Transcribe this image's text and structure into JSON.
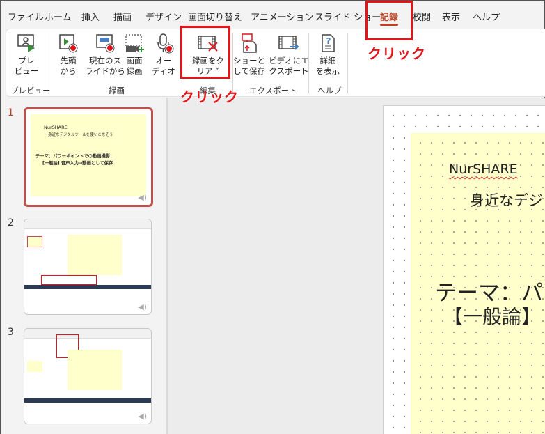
{
  "menu": {
    "tabs": [
      {
        "label": "ファイル"
      },
      {
        "label": "ホーム"
      },
      {
        "label": "挿入"
      },
      {
        "label": "描画"
      },
      {
        "label": "デザイン"
      },
      {
        "label": "画面切り替え"
      },
      {
        "label": "アニメーション"
      },
      {
        "label": "スライド ショー"
      },
      {
        "label": "記録"
      },
      {
        "label": "校閲"
      },
      {
        "label": "表示"
      },
      {
        "label": "ヘルプ"
      }
    ],
    "active_tab": "記録"
  },
  "ribbon": {
    "buttons": {
      "preview": "プレ\nビュー",
      "from_start": "先頭\nから",
      "from_current": "現在のス\nライドから",
      "screen": "画面\n録画",
      "audio": "オー\nディオ",
      "clear": "録画をク\nリア ˅",
      "save_as_show": "ショーと\nして保存",
      "export_video": "ビデオにエ\nクスポート",
      "details": "詳細\nを表示"
    },
    "groups": {
      "preview": "プレビュー",
      "record": "録画",
      "edit": "編集",
      "export": "エクスポート",
      "help": "ヘルプ"
    }
  },
  "annotations": {
    "click_record_tab": "クリック",
    "click_clear": "クリック"
  },
  "slides": [
    {
      "number": "1",
      "title": "NurSHARE",
      "subtitle": "身近なデジタルツールを使いこなそう",
      "theme_line1": "テーマ：パワーポイントでの動画撮影：",
      "theme_line2": "[一般論] 音声入力→動画として保存"
    },
    {
      "number": "2"
    },
    {
      "number": "3"
    }
  ],
  "slide_view": {
    "title": "NurSHARE",
    "subtitle_partial": "身近なデジ",
    "theme_partial_1": "テーマ：パ",
    "theme_partial_2": "【一般論】"
  },
  "colors": {
    "accent": "#c43e1c",
    "annotation_red": "#e2151b",
    "slide_yellow": "#ffffcc"
  }
}
